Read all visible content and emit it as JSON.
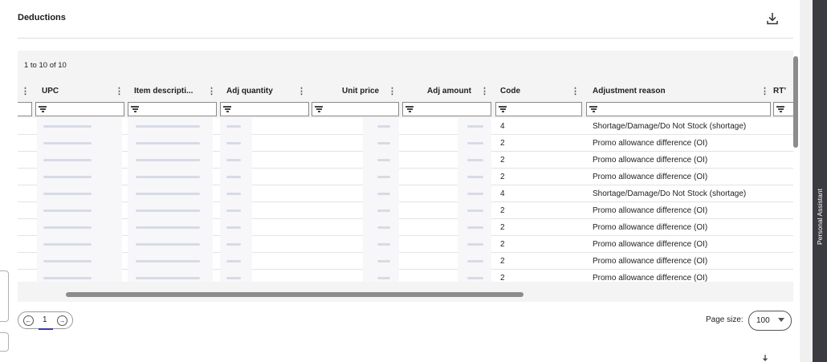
{
  "panel": {
    "title": "Deductions"
  },
  "grid": {
    "row_count_label": "1 to 10 of 10",
    "columns": [
      {
        "key": "upc",
        "label": "UPC"
      },
      {
        "key": "item",
        "label": "Item descripti..."
      },
      {
        "key": "adjq",
        "label": "Adj quantity"
      },
      {
        "key": "unit",
        "label": "Unit price"
      },
      {
        "key": "amt",
        "label": "Adj amount"
      },
      {
        "key": "code",
        "label": "Code"
      },
      {
        "key": "reason",
        "label": "Adjustment reason"
      },
      {
        "key": "rt",
        "label": "RT’"
      }
    ],
    "rows": [
      {
        "code": "4",
        "reason": "Shortage/Damage/Do Not Stock (shortage)"
      },
      {
        "code": "2",
        "reason": "Promo allowance difference (OI)"
      },
      {
        "code": "2",
        "reason": "Promo allowance difference (OI)"
      },
      {
        "code": "2",
        "reason": "Promo allowance difference (OI)"
      },
      {
        "code": "4",
        "reason": "Shortage/Damage/Do Not Stock (shortage)"
      },
      {
        "code": "2",
        "reason": "Promo allowance difference (OI)"
      },
      {
        "code": "2",
        "reason": "Promo allowance difference (OI)"
      },
      {
        "code": "2",
        "reason": "Promo allowance difference (OI)"
      },
      {
        "code": "2",
        "reason": "Promo allowance difference (OI)"
      },
      {
        "code": "2",
        "reason": "Promo allowance difference (OI)"
      }
    ]
  },
  "pagination": {
    "current_page": "1",
    "page_size_label": "Page size:",
    "page_size_value": "100"
  },
  "assistant": {
    "label": "Personal Assistant"
  },
  "icons": {
    "download": "download-icon",
    "menu": "column-menu-icon",
    "filter": "filter-icon",
    "prev": "previous-page-icon",
    "next": "next-page-icon",
    "caret": "chevron-down-icon"
  }
}
